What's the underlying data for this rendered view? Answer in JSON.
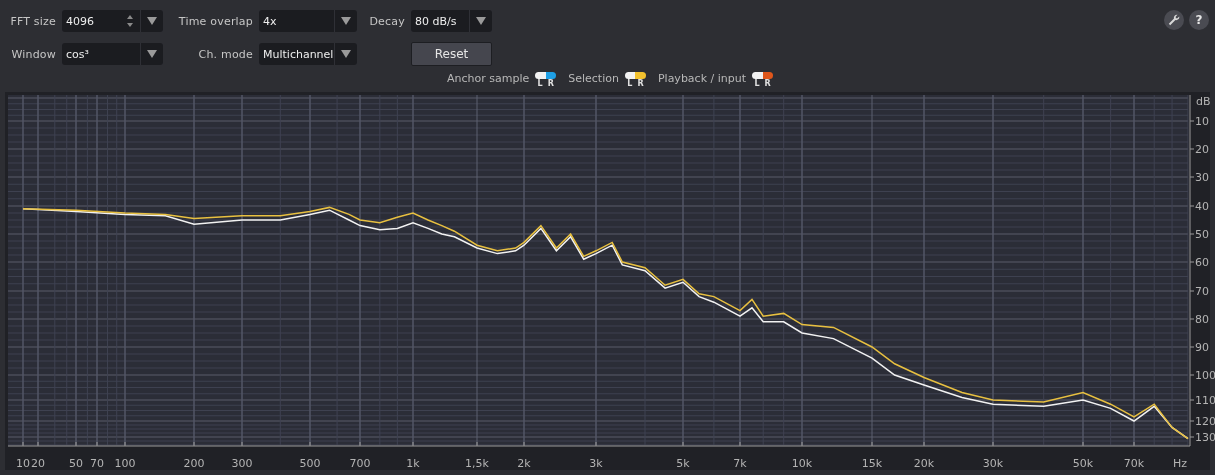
{
  "settings": [
    {
      "kind": "spinbox",
      "label": "FFT size",
      "value": "4096"
    },
    {
      "kind": "dropdown",
      "label": "Time overlap",
      "value": "4x"
    },
    {
      "kind": "dropdown",
      "label": "Decay",
      "value": "80 dB/s"
    },
    {
      "kind": "dropdown",
      "label": "Window",
      "value": "cos³"
    },
    {
      "kind": "dropdown",
      "label": "Ch. mode",
      "value": "Multichannel"
    }
  ],
  "reset_button": "Reset",
  "help_button": "?",
  "legend": [
    {
      "label": "Anchor sample",
      "left": "L",
      "right": "R",
      "color": "#1ea0e6"
    },
    {
      "label": "Selection",
      "left": "L",
      "right": "R",
      "color": "#f2c12e"
    },
    {
      "label": "Playback / input",
      "left": "L",
      "right": "R",
      "color": "#e0561b"
    }
  ],
  "spectrum": {
    "x_labels": [
      "10",
      "20",
      "50",
      "70",
      "100",
      "200",
      "300",
      "500",
      "700",
      "1k",
      "1,5k",
      "2k",
      "3k",
      "5k",
      "7k",
      "10k",
      "15k",
      "20k",
      "30k",
      "50k",
      "70k"
    ],
    "x_unit": "Hz",
    "y_unit": "dB",
    "y_labels": [
      "10",
      "20",
      "30",
      "40",
      "50",
      "60",
      "70",
      "80",
      "90",
      "100",
      "110",
      "120",
      "130"
    ]
  }
}
